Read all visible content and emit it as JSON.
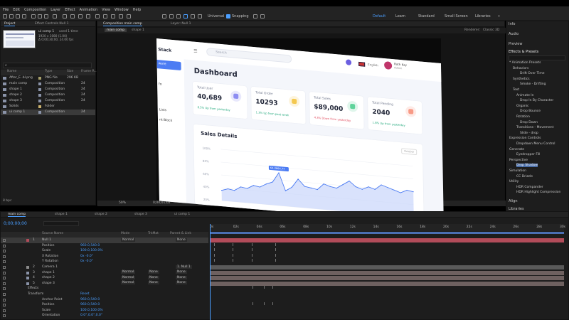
{
  "menu": [
    "File",
    "Edit",
    "Composition",
    "Layer",
    "Effect",
    "Animation",
    "View",
    "Window",
    "Help"
  ],
  "toolbar": {
    "universal": "Universal",
    "snapping": "Snapping",
    "workspaces": [
      "Default",
      "Learn",
      "Standard",
      "Small Screen",
      "Libraries"
    ],
    "active_workspace": "Default"
  },
  "project": {
    "tab_project": "Project",
    "tab_effect_controls": "Effect Controls Null 1",
    "thumb_title": "ui comp 1",
    "thumb_used": "used 1 time",
    "thumb_info1": "1920 x 1080 (1.00)",
    "thumb_info2": "Δ 0;00;30;00, 24.00 fps",
    "search_placeholder": "",
    "col_name": "Name",
    "col_type": "Type",
    "col_size": "Size",
    "col_fr": "Frame R...",
    "items": [
      {
        "name": "After_E..bl.png",
        "type": "PNG file",
        "size": "296 KB",
        "fr": "",
        "color": "#a8a06a"
      },
      {
        "name": "main comp",
        "type": "Composition",
        "size": "",
        "fr": "24",
        "color": "#8a93a8"
      },
      {
        "name": "shape 1",
        "type": "Composition",
        "size": "",
        "fr": "24",
        "color": "#8a93a8"
      },
      {
        "name": "shape 2",
        "type": "Composition",
        "size": "",
        "fr": "24",
        "color": "#8a93a8"
      },
      {
        "name": "shape 3",
        "type": "Composition",
        "size": "",
        "fr": "24",
        "color": "#8a93a8"
      },
      {
        "name": "Solids",
        "type": "Folder",
        "size": "",
        "fr": "",
        "color": "#c9b06d"
      },
      {
        "name": "ui comp 1",
        "type": "Composition",
        "size": "",
        "fr": "24",
        "color": "#8a93a8"
      }
    ],
    "bpc": "8 bpc"
  },
  "comp": {
    "tab_comp": "Composition main comp",
    "tab_layer": "Layer: Null 1",
    "sub_tabs": [
      "main comp",
      "shape 1"
    ],
    "renderer": "Renderer:",
    "classic3d": "Classic 3D",
    "zoom": "50%",
    "timecode": "0;00;01;02",
    "resolution": "(Half)",
    "camera": "Active Camera",
    "view": "1 View",
    "offset": "+0.0"
  },
  "dashboard": {
    "brand": "Stack",
    "nav": [
      "ware",
      "fo",
      "Lists",
      "nt Block"
    ],
    "search": "Search",
    "lang": "English",
    "user_name": "Ruth Kay",
    "user_role": "Admin",
    "title": "Dashboard",
    "cards": [
      {
        "label": "Total User",
        "value": "40,689",
        "change": "8.5% Up from yesterday",
        "up": true,
        "icon_color": "#8d8df2"
      },
      {
        "label": "Total Order",
        "value": "10293",
        "change": "1.3% Up from past week",
        "up": true,
        "icon_color": "#f4c84f"
      },
      {
        "label": "Total Sales",
        "value": "$89,000",
        "change": "4.3% Down from yesterday",
        "up": false,
        "icon_color": "#5fd39b"
      },
      {
        "label": "Total Pending",
        "value": "2040",
        "change": "1.8% Up from yesterday",
        "up": true,
        "icon_color": "#f89a86"
      }
    ],
    "sales_title": "Sales Details",
    "month": "October",
    "tooltip": "64,3664.77",
    "y_labels": [
      "100%",
      "80%",
      "60%",
      "40%",
      "20%"
    ]
  },
  "chart_data": {
    "type": "area",
    "x": [
      0,
      1,
      2,
      3,
      4,
      5,
      6,
      7,
      8,
      9,
      10,
      11,
      12,
      13,
      14,
      15,
      16,
      17,
      18,
      19,
      20,
      21,
      22,
      23,
      24,
      25,
      26,
      27,
      28,
      29,
      30
    ],
    "values": [
      20,
      24,
      22,
      30,
      28,
      35,
      33,
      40,
      45,
      64,
      30,
      38,
      55,
      42,
      40,
      38,
      50,
      46,
      44,
      52,
      60,
      50,
      46,
      52,
      48,
      58,
      54,
      50,
      46,
      52,
      50
    ]
  },
  "right_panel": {
    "info": "Info",
    "audio": "Audio",
    "preview": "Preview",
    "effects_tab": "Effects & Presets",
    "tree": [
      {
        "label": "* Animation Presets",
        "indent": 0
      },
      {
        "label": "Behaviors",
        "indent": 1
      },
      {
        "label": "Drift Over Time",
        "indent": 3
      },
      {
        "label": "Synthetics",
        "indent": 1
      },
      {
        "label": "Smoke - Drifting",
        "indent": 3
      },
      {
        "label": "Text",
        "indent": 1
      },
      {
        "label": "Animate In",
        "indent": 2
      },
      {
        "label": "Drop In By Character",
        "indent": 3
      },
      {
        "label": "Organic",
        "indent": 2
      },
      {
        "label": "Drop Bounce",
        "indent": 3
      },
      {
        "label": "Rotation",
        "indent": 2
      },
      {
        "label": "Drop Down",
        "indent": 3
      },
      {
        "label": "Transitions - Movement",
        "indent": 2
      },
      {
        "label": "Slide - drop",
        "indent": 3
      },
      {
        "label": "Expression Controls",
        "indent": 0
      },
      {
        "label": "Dropdown Menu Control",
        "indent": 2
      },
      {
        "label": "Generate",
        "indent": 0
      },
      {
        "label": "Eyedropper Fill",
        "indent": 2
      },
      {
        "label": "Perspective",
        "indent": 0
      },
      {
        "label": "Drop Shadow",
        "indent": 2
      },
      {
        "label": "Simulation",
        "indent": 0
      },
      {
        "label": "CC Drizzle",
        "indent": 2
      },
      {
        "label": "Utility",
        "indent": 0
      },
      {
        "label": "HDR Compander",
        "indent": 2
      },
      {
        "label": "HDR Highlight Compression",
        "indent": 2
      }
    ],
    "align": "Align",
    "libraries": "Libraries"
  },
  "timeline": {
    "tabs": [
      "main comp",
      "shape 1",
      "shape 2",
      "shape 3",
      "ui comp 1"
    ],
    "timecode": "0;00;00;00",
    "col_source": "Source Name",
    "col_mode": "Mode",
    "col_trkmat": "TrkMat",
    "col_parent": "Parent & Link",
    "layers": [
      {
        "num": "1",
        "name": "Null 1",
        "mode": "Normal",
        "trk": "",
        "parent": "None",
        "color": "#b24c5a",
        "selected": true
      },
      {
        "num": "",
        "name": "Position",
        "mode": "",
        "trk": "",
        "parent": "",
        "value": "960.0,540.0",
        "color": ""
      },
      {
        "num": "",
        "name": "Scale",
        "mode": "",
        "trk": "",
        "parent": "",
        "value": "100.0,100.0%",
        "color": ""
      },
      {
        "num": "",
        "name": "X Rotation",
        "mode": "",
        "trk": "",
        "parent": "",
        "value": "0x -0.0°",
        "color": ""
      },
      {
        "num": "",
        "name": "Y Rotation",
        "mode": "",
        "trk": "",
        "parent": "",
        "value": "0x -0.0°",
        "color": ""
      },
      {
        "num": "2",
        "name": "Camera 1",
        "mode": "",
        "trk": "",
        "parent": "1. Null 1",
        "color": "#8a8a8a"
      },
      {
        "num": "3",
        "name": "shape 1",
        "mode": "Normal",
        "trk": "None",
        "parent": "None",
        "color": "#8a93a8"
      },
      {
        "num": "4",
        "name": "shape 2",
        "mode": "Normal",
        "trk": "None",
        "parent": "None",
        "color": "#8a93a8"
      },
      {
        "num": "5",
        "name": "shape 3",
        "mode": "Normal",
        "trk": "None",
        "parent": "None",
        "color": "#8a93a8"
      },
      {
        "num": "",
        "name": "Effects",
        "mode": "",
        "trk": "",
        "parent": "",
        "color": ""
      },
      {
        "num": "",
        "name": "Transform",
        "mode": "",
        "trk": "",
        "parent": "",
        "value": "Reset",
        "color": ""
      },
      {
        "num": "",
        "name": "Anchor Point",
        "mode": "",
        "trk": "",
        "parent": "",
        "value": "960.0,540.0",
        "color": ""
      },
      {
        "num": "",
        "name": "Position",
        "mode": "",
        "trk": "",
        "parent": "",
        "value": "960.0,540.0",
        "color": ""
      },
      {
        "num": "",
        "name": "Scale",
        "mode": "",
        "trk": "",
        "parent": "",
        "value": "100.0,100.0%",
        "color": ""
      },
      {
        "num": "",
        "name": "Orientation",
        "mode": "",
        "trk": "",
        "parent": "",
        "value": "0.0°,0.0°,0.0°",
        "color": ""
      }
    ],
    "ruler": [
      "0s",
      "02s",
      "04s",
      "06s",
      "08s",
      "10s",
      "12s",
      "14s",
      "16s",
      "18s",
      "20s",
      "22s",
      "24s",
      "26s",
      "28s",
      "30s"
    ]
  }
}
